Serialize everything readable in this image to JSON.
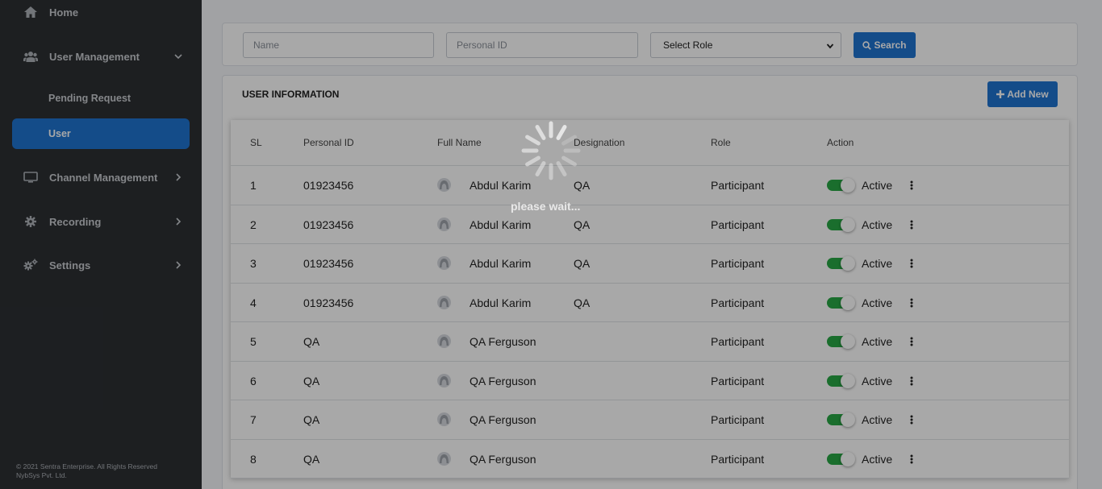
{
  "sidebar": {
    "home": "Home",
    "user_management": "User Management",
    "pending_request": "Pending Request",
    "user": "User",
    "channel_management": "Channel Management",
    "recording": "Recording",
    "settings": "Settings",
    "copyright_line1": "© 2021 Sentra Enterprise. All Rights Reserved",
    "copyright_line2": "NybSys Pvt. Ltd."
  },
  "search": {
    "name_placeholder": "Name",
    "personal_id_placeholder": "Personal ID",
    "role_selected": "Select Role",
    "search_button": "Search"
  },
  "user_info": {
    "title": "USER INFORMATION",
    "add_new_button": "Add New"
  },
  "table": {
    "headers": [
      "SL",
      "Personal ID",
      "Full Name",
      "Designation",
      "Role",
      "Action"
    ],
    "rows": [
      {
        "sl": "1",
        "personal_id": "01923456",
        "full_name": "Abdul Karim",
        "designation": "QA",
        "role": "Participant",
        "status": "Active"
      },
      {
        "sl": "2",
        "personal_id": "01923456",
        "full_name": "Abdul Karim",
        "designation": "QA",
        "role": "Participant",
        "status": "Active"
      },
      {
        "sl": "3",
        "personal_id": "01923456",
        "full_name": "Abdul Karim",
        "designation": "QA",
        "role": "Participant",
        "status": "Active"
      },
      {
        "sl": "4",
        "personal_id": "01923456",
        "full_name": "Abdul Karim",
        "designation": "QA",
        "role": "Participant",
        "status": "Active"
      },
      {
        "sl": "5",
        "personal_id": "QA",
        "full_name": "QA Ferguson",
        "designation": "",
        "role": "Participant",
        "status": "Active"
      },
      {
        "sl": "6",
        "personal_id": "QA",
        "full_name": "QA Ferguson",
        "designation": "",
        "role": "Participant",
        "status": "Active"
      },
      {
        "sl": "7",
        "personal_id": "QA",
        "full_name": "QA Ferguson",
        "designation": "",
        "role": "Participant",
        "status": "Active"
      },
      {
        "sl": "8",
        "personal_id": "QA",
        "full_name": "QA Ferguson",
        "designation": "",
        "role": "Participant",
        "status": "Active"
      }
    ]
  },
  "loading": {
    "text": "please wait..."
  },
  "colors": {
    "sidebar_bg": "#2c2f33",
    "accent": "#1f74d1",
    "toggle_on": "#28a745"
  }
}
